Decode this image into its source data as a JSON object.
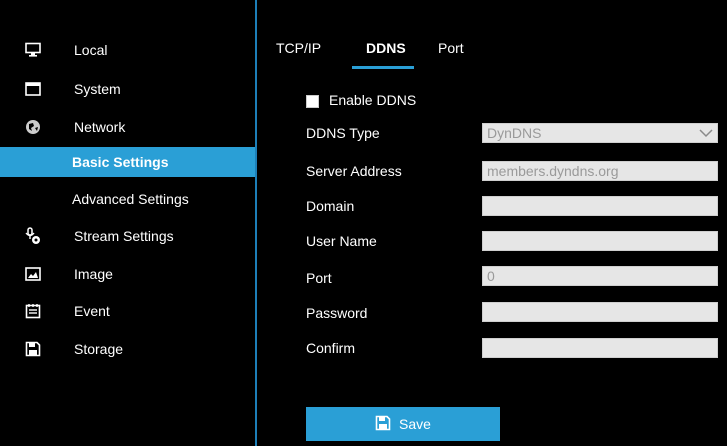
{
  "sidebar": {
    "items": [
      {
        "label": "Local",
        "icon": "monitor-icon"
      },
      {
        "label": "System",
        "icon": "window-icon"
      },
      {
        "label": "Network",
        "icon": "globe-icon"
      },
      {
        "label": "Basic Settings",
        "active": true
      },
      {
        "label": "Advanced Settings"
      },
      {
        "label": "Stream Settings",
        "icon": "stream-icon"
      },
      {
        "label": "Image",
        "icon": "image-icon"
      },
      {
        "label": "Event",
        "icon": "calendar-icon"
      },
      {
        "label": "Storage",
        "icon": "floppy-icon"
      }
    ]
  },
  "tabs": [
    {
      "label": "TCP/IP"
    },
    {
      "label": "DDNS",
      "active": true
    },
    {
      "label": "Port"
    }
  ],
  "form": {
    "enable_label": "Enable DDNS",
    "enable_checked": false,
    "ddns_type_label": "DDNS Type",
    "ddns_type_value": "DynDNS",
    "server_address_label": "Server Address",
    "server_address_value": "members.dyndns.org",
    "domain_label": "Domain",
    "domain_value": "",
    "user_name_label": "User Name",
    "user_name_value": "",
    "port_label": "Port",
    "port_value": "0",
    "password_label": "Password",
    "password_value": "",
    "confirm_label": "Confirm",
    "confirm_value": ""
  },
  "save_label": "Save",
  "colors": {
    "accent": "#2a9fd6",
    "field_bg": "#e6e6e6"
  }
}
